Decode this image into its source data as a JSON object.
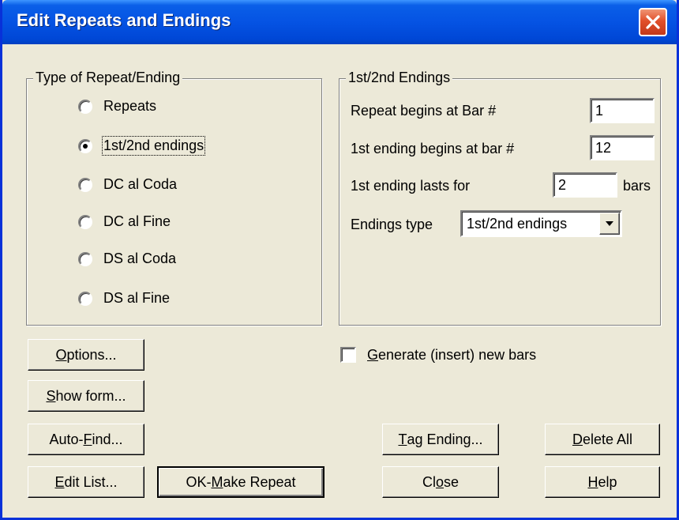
{
  "window": {
    "title": "Edit Repeats and Endings"
  },
  "type_group": {
    "legend": "Type of Repeat/Ending",
    "options": [
      {
        "label": "Repeats",
        "checked": false
      },
      {
        "label": "1st/2nd endings",
        "checked": true
      },
      {
        "label": "DC al Coda",
        "checked": false
      },
      {
        "label": "DC al Fine",
        "checked": false
      },
      {
        "label": "DS al Coda",
        "checked": false
      },
      {
        "label": "DS al Fine",
        "checked": false
      }
    ]
  },
  "endings_group": {
    "legend": "1st/2nd Endings",
    "repeat_begins_label": "Repeat begins at Bar #",
    "repeat_begins_value": "1",
    "first_ending_begins_label": "1st ending begins at bar #",
    "first_ending_begins_value": "12",
    "first_ending_lasts_label": "1st ending lasts for",
    "first_ending_lasts_value": "2",
    "bars_unit": "bars",
    "endings_type_label": "Endings type",
    "endings_type_value": "1st/2nd endings"
  },
  "generate_checkbox": {
    "label_mnemonic": "G",
    "label_rest": "enerate (insert) new bars",
    "checked": false
  },
  "buttons": {
    "options": {
      "pre": "",
      "mnemonic": "O",
      "post": "ptions..."
    },
    "show_form": {
      "pre": "",
      "mnemonic": "S",
      "post": "how form..."
    },
    "auto_find": {
      "pre": "Auto-",
      "mnemonic": "F",
      "post": "ind..."
    },
    "edit_list": {
      "pre": "",
      "mnemonic": "E",
      "post": "dit List..."
    },
    "ok_make_repeat": {
      "pre": "OK-",
      "mnemonic": "M",
      "post": "ake Repeat"
    },
    "tag_ending": {
      "pre": "",
      "mnemonic": "T",
      "post": "ag Ending..."
    },
    "delete_all": {
      "pre": "",
      "mnemonic": "D",
      "post": "elete All"
    },
    "close": {
      "pre": "Cl",
      "mnemonic": "o",
      "post": "se"
    },
    "help": {
      "pre": "",
      "mnemonic": "H",
      "post": "elp"
    }
  },
  "icons": {
    "close": "close-icon",
    "dropdown": "chevron-down-icon"
  },
  "colors": {
    "titlebar": "#0553e3",
    "dialog_bg": "#ece9d8",
    "close_button": "#e1502a"
  }
}
